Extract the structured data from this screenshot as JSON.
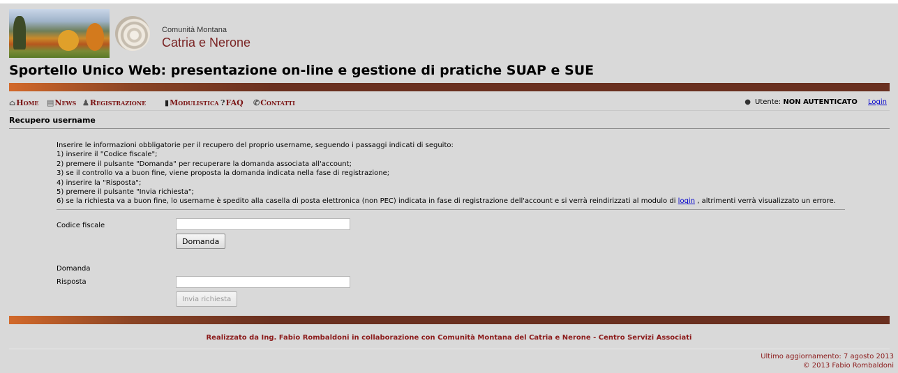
{
  "header": {
    "org_line1": "Comunità Montana",
    "org_line2": "Catria e Nerone",
    "title": "Sportello Unico Web: presentazione on-line e gestione di pratiche SUAP e SUE"
  },
  "nav": {
    "items": [
      {
        "label": "Home",
        "icon": "home-icon"
      },
      {
        "label": "News",
        "icon": "news-icon"
      },
      {
        "label": "Registrazione",
        "icon": "add-user-icon"
      },
      {
        "label": "Modulistica",
        "icon": "document-icon"
      },
      {
        "label": "FAQ",
        "icon": "question-icon"
      },
      {
        "label": "Contatti",
        "icon": "phone-icon"
      }
    ],
    "user_label": "Utente:",
    "user_status": "NON AUTENTICATO",
    "login_label": "Login"
  },
  "section_title": "Recupero username",
  "instructions": {
    "intro": "Inserire le informazioni obbligatorie per il recupero del proprio username, seguendo i passaggi indicati di seguito:",
    "steps": [
      "1) inserire il \"Codice fiscale\";",
      "2) premere il pulsante \"Domanda\" per recuperare la domanda associata all'account;",
      "3) se il controllo va a buon fine, viene proposta la domanda indicata nella fase di registrazione;",
      "4) inserire la \"Risposta\";",
      "5) premere il pulsante \"Invia richiesta\";"
    ],
    "step6_before": "6) se la richiesta va a buon fine, lo username è spedito alla casella di posta elettronica (non PEC) indicata in fase di registrazione dell'account e si verrà reindirizzati al modulo di ",
    "step6_link": "login",
    "step6_after": " , altrimenti verrà visualizzato un errore."
  },
  "form": {
    "codice_fiscale_label": "Codice fiscale",
    "codice_fiscale_value": "",
    "domanda_button": "Domanda",
    "domanda_label": "Domanda",
    "risposta_label": "Risposta",
    "risposta_value": "",
    "invia_button": "Invia richiesta"
  },
  "footer": {
    "credit": "Realizzato da Ing. Fabio Rombaldoni in collaborazione con Comunità Montana del Catria e Nerone - Centro Servizi Associati",
    "updated": "Ultimo aggiornamento: 7 agosto 2013",
    "copyright": "© 2013 Fabio Rombaldoni"
  },
  "colors": {
    "background": "#d9d9d9",
    "brand_red": "#7a1414",
    "footer_red": "#8b1a1a",
    "bar_brown": "#6a3020",
    "bar_orange": "#d2692a",
    "link_blue": "#0000cc"
  }
}
